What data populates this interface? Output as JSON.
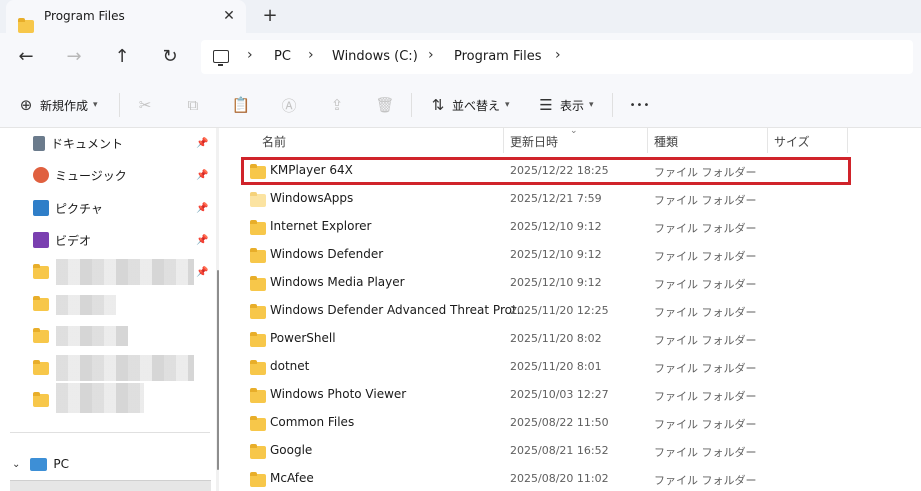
{
  "tab": {
    "title": "Program Files",
    "close": "✕",
    "add": "+"
  },
  "nav": {
    "back": "←",
    "forward": "→",
    "up": "↑",
    "refresh": "↻"
  },
  "breadcrumb": [
    "PC",
    "Windows (C:)",
    "Program Files"
  ],
  "toolbar": {
    "new_label": "新規作成",
    "sort_label": "並べ替え",
    "view_label": "表示",
    "more": "•••"
  },
  "sidebar": {
    "quick": [
      {
        "label": "ドキュメント",
        "icon": "documents-icon"
      },
      {
        "label": "ミュージック",
        "icon": "music-icon"
      },
      {
        "label": "ピクチャ",
        "icon": "pictures-icon"
      },
      {
        "label": "ビデオ",
        "icon": "videos-icon"
      }
    ],
    "pc_label": "PC"
  },
  "columns": {
    "name": "名前",
    "modified": "更新日時",
    "type": "種類",
    "size": "サイズ"
  },
  "files": [
    {
      "name": "KMPlayer 64X",
      "modified": "2025/12/22 18:25",
      "type": "ファイル フォルダー"
    },
    {
      "name": "WindowsApps",
      "modified": "2025/12/21 7:59",
      "type": "ファイル フォルダー"
    },
    {
      "name": "Internet Explorer",
      "modified": "2025/12/10 9:12",
      "type": "ファイル フォルダー"
    },
    {
      "name": "Windows Defender",
      "modified": "2025/12/10 9:12",
      "type": "ファイル フォルダー"
    },
    {
      "name": "Windows Media Player",
      "modified": "2025/12/10 9:12",
      "type": "ファイル フォルダー"
    },
    {
      "name": "Windows Defender Advanced Threat Prot...",
      "modified": "2025/11/20 12:25",
      "type": "ファイル フォルダー"
    },
    {
      "name": "PowerShell",
      "modified": "2025/11/20 8:02",
      "type": "ファイル フォルダー"
    },
    {
      "name": "dotnet",
      "modified": "2025/11/20 8:01",
      "type": "ファイル フォルダー"
    },
    {
      "name": "Windows Photo Viewer",
      "modified": "2025/10/03 12:27",
      "type": "ファイル フォルダー"
    },
    {
      "name": "Common Files",
      "modified": "2025/08/22 11:50",
      "type": "ファイル フォルダー"
    },
    {
      "name": "Google",
      "modified": "2025/08/21 16:52",
      "type": "ファイル フォルダー"
    },
    {
      "name": "McAfee",
      "modified": "2025/08/20 11:02",
      "type": "ファイル フォルダー"
    }
  ],
  "colors": {
    "highlight": "#d0232a",
    "folder": "#f7c74a"
  }
}
